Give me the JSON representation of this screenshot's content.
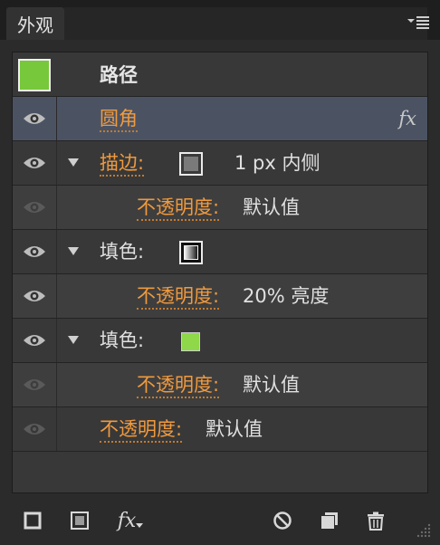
{
  "panel": {
    "tab_title": "外观",
    "target_label": "路径",
    "target_swatch_color": "#77c83a"
  },
  "rows": {
    "effect": {
      "label": "圆角",
      "fx": "fx"
    },
    "stroke": {
      "label": "描边:",
      "value": "1 px  内侧"
    },
    "stroke_opacity": {
      "label": "不透明度:",
      "value": "默认值"
    },
    "fill1": {
      "label": "填色:"
    },
    "fill1_opacity": {
      "label": "不透明度:",
      "value": "20% 亮度"
    },
    "fill2": {
      "label": "填色:",
      "swatch_color": "#8ed84a"
    },
    "fill2_opacity": {
      "label": "不透明度:",
      "value": "默认值"
    },
    "opacity": {
      "label": "不透明度:",
      "value": "默认值"
    }
  },
  "toolbar": {
    "fx_label": "fx"
  },
  "colors": {
    "accent_link": "#f09a3e",
    "selected_row": "#4b5363"
  }
}
